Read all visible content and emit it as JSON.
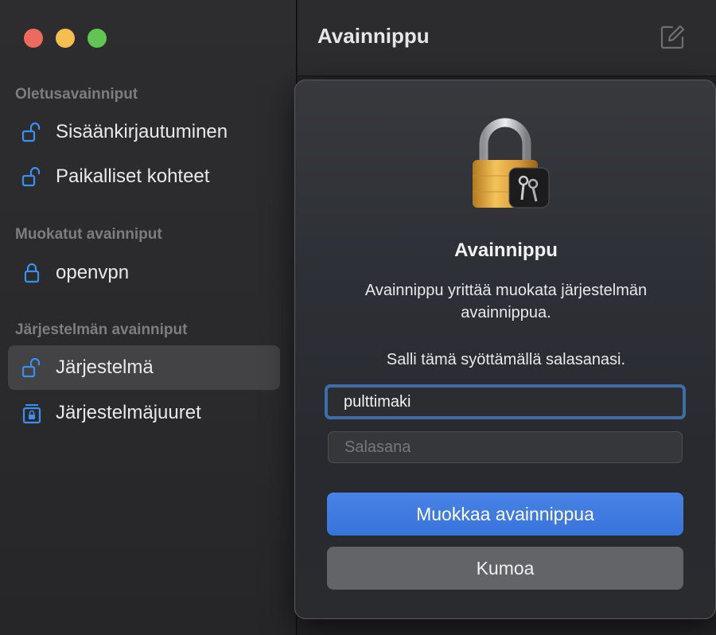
{
  "window": {
    "traffic_lights": [
      "close",
      "minimize",
      "zoom"
    ]
  },
  "sidebar": {
    "sections": [
      {
        "title": "Oletusavainniput",
        "items": [
          {
            "label": "Sisäänkirjautuminen",
            "icon": "unlocked-lock-icon"
          },
          {
            "label": "Paikalliset kohteet",
            "icon": "unlocked-lock-icon"
          }
        ]
      },
      {
        "title": "Muokatut avainniput",
        "items": [
          {
            "label": "openvpn",
            "icon": "locked-lock-icon"
          }
        ]
      },
      {
        "title": "Järjestelmän avainniput",
        "items": [
          {
            "label": "Järjestelmä",
            "icon": "unlocked-lock-icon",
            "selected": true
          },
          {
            "label": "Järjestelmäjuuret",
            "icon": "cabinet-lock-icon"
          }
        ]
      }
    ]
  },
  "main": {
    "title": "Avainnippu",
    "compose_icon": "compose-icon"
  },
  "dialog": {
    "title": "Avainnippu",
    "message": "Avainnippu yrittää muokata järjestelmän avainnippua.",
    "allow_text": "Salli tämä syöttämällä salasanasi.",
    "username_value": "pulttimaki",
    "password_placeholder": "Salasana",
    "primary_button": "Muokkaa avainnippua",
    "cancel_button": "Kumoa"
  },
  "colors": {
    "accent": "#3774da",
    "sidebar_icon": "#3b8ff0",
    "selected_row": "#434346"
  }
}
